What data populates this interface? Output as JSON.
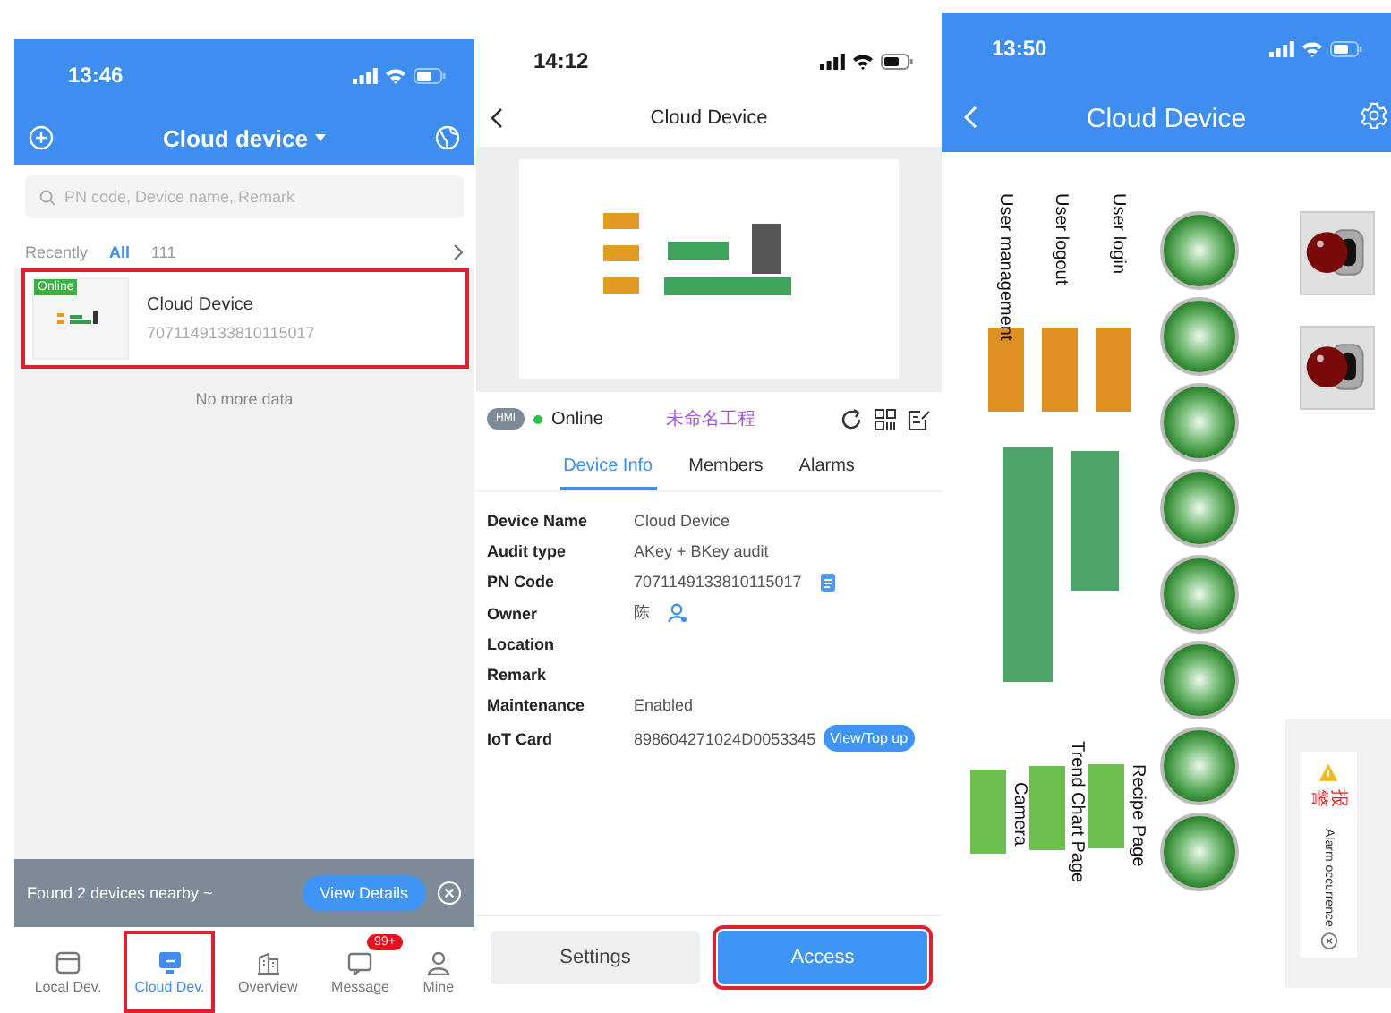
{
  "device_list_screen": {
    "status_bar": {
      "time": "13:46"
    },
    "header": {
      "title": "Cloud device"
    },
    "search": {
      "placeholder": "PN code, Device name, Remark"
    },
    "filters": [
      {
        "label": "Recently",
        "selected": false
      },
      {
        "label": "All",
        "selected": true
      },
      {
        "label": "111",
        "selected": false
      }
    ],
    "devices": [
      {
        "badge": "Online",
        "name": "Cloud Device",
        "pn_code": "7071149133810115017",
        "highlighted": true
      }
    ],
    "list_end": "No more data",
    "nearby_banner": {
      "text": "Found 2 devices nearby ~",
      "button": "View Details"
    },
    "tab_bar": [
      {
        "kind": "local",
        "label": "Local Dev.",
        "selected": false,
        "highlighted": false
      },
      {
        "kind": "cloud",
        "label": "Cloud Dev.",
        "selected": true,
        "highlighted": true
      },
      {
        "kind": "overview",
        "label": "Overview",
        "selected": false,
        "highlighted": false
      },
      {
        "kind": "message",
        "label": "Message",
        "selected": false,
        "highlighted": false,
        "badge": "99+"
      },
      {
        "kind": "mine",
        "label": "Mine",
        "selected": false,
        "highlighted": false
      }
    ]
  },
  "device_detail_screen": {
    "status_bar": {
      "time": "14:12"
    },
    "header": {
      "title": "Cloud Device"
    },
    "device_type": "HMI",
    "status": {
      "label": "Online",
      "color": "#2fbf4a"
    },
    "project": "未命名工程",
    "tabs": [
      {
        "label": "Device Info",
        "selected": true
      },
      {
        "label": "Members",
        "selected": false
      },
      {
        "label": "Alarms",
        "selected": false
      }
    ],
    "fields": [
      {
        "kind": "plain",
        "label": "Device Name",
        "value": "Cloud Device"
      },
      {
        "kind": "plain",
        "label": "Audit type",
        "value": "AKey + BKey audit"
      },
      {
        "kind": "copy",
        "label": "PN Code",
        "value": "7071149133810115017"
      },
      {
        "kind": "user",
        "label": "Owner",
        "value": "陈"
      },
      {
        "kind": "plain",
        "label": "Location"
      },
      {
        "kind": "plain",
        "label": "Remark"
      },
      {
        "kind": "plain",
        "label": "Maintenance",
        "value": "Enabled"
      },
      {
        "kind": "action",
        "label": "IoT Card",
        "value": "898604271024D0053345",
        "action": "View/Top up"
      }
    ],
    "buttons": [
      {
        "kind": "secondary",
        "label": "Settings",
        "highlighted": false
      },
      {
        "kind": "primary",
        "label": "Access",
        "highlighted": true
      }
    ]
  },
  "hmi_screen": {
    "status_bar": {
      "time": "13:50"
    },
    "header": {
      "title": "Cloud Device"
    },
    "top_buttons": [
      "User management",
      "User logout",
      "User login"
    ],
    "bottom_buttons": [
      "Camera",
      "Trend Chart Page",
      "Recipe Page"
    ],
    "alarm_popup": {
      "title": "报警",
      "message": "Alarm occurrence"
    }
  }
}
